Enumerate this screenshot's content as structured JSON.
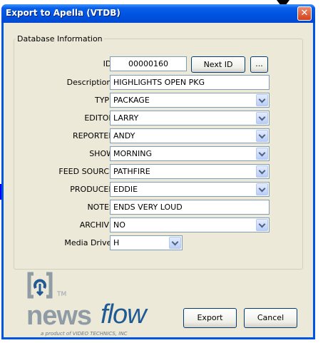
{
  "window": {
    "title": "Export to Apella (VTDB)",
    "close_symbol": "✕"
  },
  "group": {
    "legend": "Database Information"
  },
  "fields": {
    "id": {
      "label": "ID:",
      "value": "00000160"
    },
    "description": {
      "label": "Description:",
      "value": "HIGHLIGHTS OPEN PKG"
    },
    "type": {
      "label": "TYPE",
      "value": "PACKAGE"
    },
    "editor": {
      "label": "EDITOR",
      "value": "LARRY"
    },
    "reporter": {
      "label": "REPORTER",
      "value": "ANDY"
    },
    "show": {
      "label": "SHOW",
      "value": "MORNING"
    },
    "feed_source": {
      "label": "FEED SOURCE",
      "value": "PATHFIRE"
    },
    "producer": {
      "label": "PRODUCER",
      "value": "EDDIE"
    },
    "notes": {
      "label": "NOTES",
      "value": "ENDS VERY LOUD"
    },
    "archive": {
      "label": "ARCHIVE",
      "value": "NO"
    },
    "media_drive": {
      "label": "Media Drive:",
      "value": "H"
    }
  },
  "buttons": {
    "next_id": "Next ID",
    "browse": "...",
    "export": "Export",
    "cancel": "Cancel"
  },
  "logo": {
    "tm": "TM",
    "news": "news",
    "flow": "flow",
    "tagline": "a product of VIDEO TECHNICS, INC"
  },
  "colors": {
    "title_bar": "#0054e3",
    "dialog_bg": "#ece9d8",
    "close_button": "#d2421b",
    "logo_gray": "#8f9ca6",
    "logo_blue": "#1f5a94"
  }
}
